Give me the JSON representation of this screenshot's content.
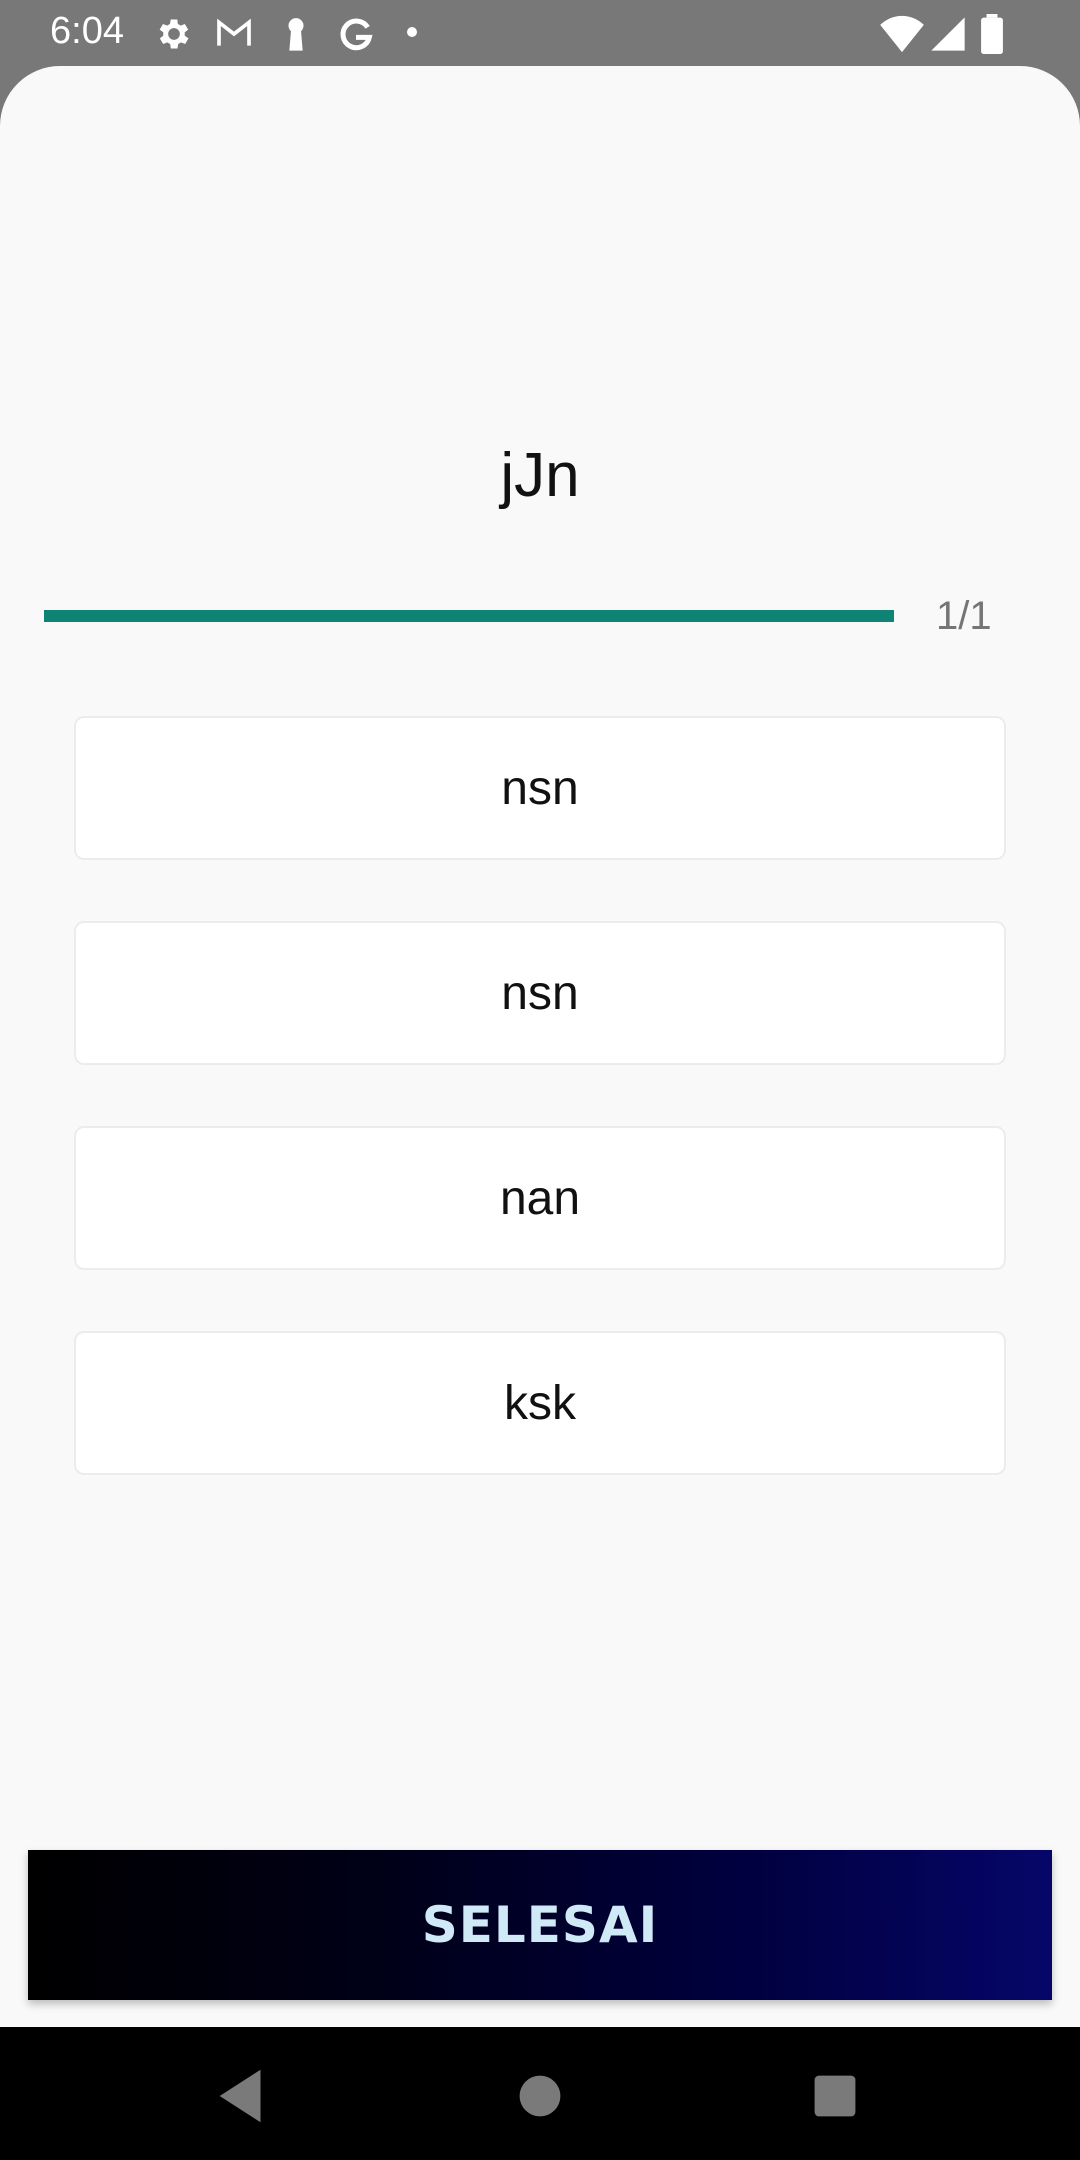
{
  "status_bar": {
    "time": "6:04",
    "icons": [
      "settings-icon",
      "gmail-icon",
      "keyhole-icon",
      "google-icon",
      "dot-icon",
      "wifi-icon",
      "signal-icon",
      "battery-icon"
    ]
  },
  "quiz": {
    "question": "jJn",
    "progress_text": "1/1",
    "progress_fraction": 1.0,
    "options": [
      {
        "label": "nsn"
      },
      {
        "label": "nsn"
      },
      {
        "label": "nan"
      },
      {
        "label": "ksk"
      }
    ],
    "finish_label": "SELESAI"
  },
  "nav_bar": {
    "buttons": [
      "back-icon",
      "home-icon",
      "recents-icon"
    ]
  },
  "colors": {
    "accent": "#0f8475",
    "button_text": "#cfe9f7",
    "status_bar": "#787878"
  }
}
